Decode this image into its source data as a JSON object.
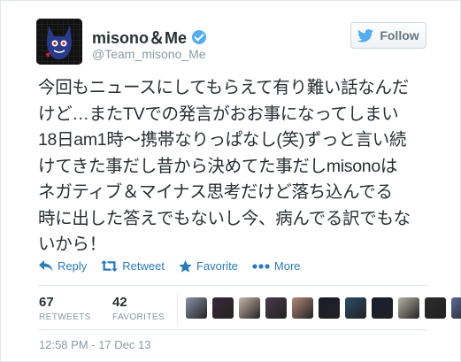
{
  "user": {
    "name": "misono＆Me",
    "handle": "@Team_misono_Me"
  },
  "follow_label": "Follow",
  "tweet_lines": [
    "今回もニュースにしてもらえて有り難い話なんだ",
    "けど…またTVでの発言がおお事になってしまい",
    "18日am1時〜携帯なりっぱなし(笑)ずっと言い続",
    "けてきた事だし昔から決めてた事だしmisonoは",
    "ネガティブ＆マイナス思考だけど落ち込んでる",
    "時に出した答えでもないし今、病んでる訳でもな",
    "いから！"
  ],
  "actions": {
    "reply": "Reply",
    "retweet": "Retweet",
    "favorite": "Favorite",
    "more": "More"
  },
  "stats": {
    "retweets_count": "67",
    "retweets_label": "RETWEETS",
    "favorites_count": "42",
    "favorites_label": "FAVORITES"
  },
  "favoriters": [
    {
      "name": "favoriter-1",
      "color": "#8a93a8"
    },
    {
      "name": "favoriter-2",
      "color": "#3a2a38"
    },
    {
      "name": "favoriter-3",
      "color": "#c7b7a8"
    },
    {
      "name": "favoriter-4",
      "color": "#4a3a4c"
    },
    {
      "name": "favoriter-5",
      "color": "#b48a7c"
    },
    {
      "name": "favoriter-6",
      "color": "#1c1c2a"
    },
    {
      "name": "favoriter-7",
      "color": "#2b4d6a"
    },
    {
      "name": "favoriter-8",
      "color": "#181c30"
    },
    {
      "name": "favoriter-9",
      "color": "#b8b2a6"
    },
    {
      "name": "favoriter-10",
      "color": "#2a2a2a"
    },
    {
      "name": "favoriter-11",
      "color": "#5a6a9a"
    }
  ],
  "timestamp": "12:58 PM - 17 Dec 13",
  "colors": {
    "link": "#2b7bb9",
    "twitter_blue": "#55acee",
    "muted": "#8899a6"
  }
}
